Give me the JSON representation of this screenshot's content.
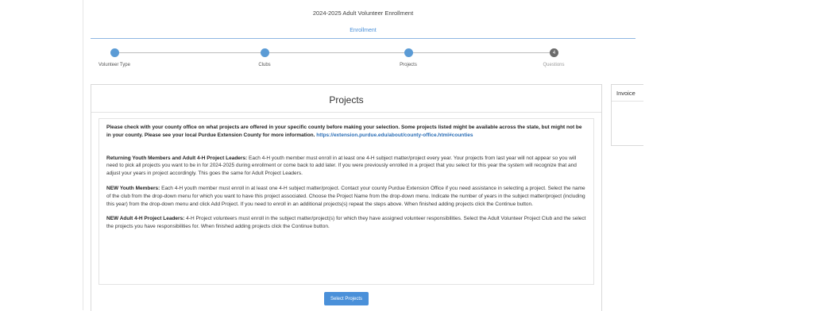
{
  "header": {
    "enrollment_title": "2024-2025 Adult Volunteer Enrollment",
    "tab_label": "Enrollment"
  },
  "steps": [
    {
      "label": "Volunteer Type",
      "number": "",
      "state": "complete"
    },
    {
      "label": "Clubs",
      "number": "",
      "state": "complete"
    },
    {
      "label": "Projects",
      "number": "",
      "state": "current"
    },
    {
      "label": "Questions",
      "number": "4",
      "state": "pending"
    }
  ],
  "projects_card": {
    "title": "Projects",
    "intro": "Please check with your county office on what projects are offered in your specific county before making your selection. Some projects listed might be available across the state, but might not be in your county. Please see your local Purdue Extension County for more information.",
    "intro_link": "https://extension.purdue.edu/about/county-office.html#counties",
    "returning_heading": "Returning Youth Members and Adult 4-H Project Leaders:",
    "returning_text": "Each 4-H youth member must enroll in at least one 4-H subject matter/project every year. Your projects from last year will not appear so you will need to pick all projects you want to be in for 2024-2025 during enrollment or come back to add later. If you were previously enrolled in a project that you select for this year the system will recognize that and adjust your years in project accordingly. This goes the same for Adult Project Leaders.",
    "new_youth_heading": "NEW Youth Members:",
    "new_youth_text": "Each 4-H youth member must enroll in at least one 4-H subject matter/project. Contact your county Purdue Extension Office if you need assistance in selecting a project. Select the name of the club from the drop-down menu for which you want to have this project associated. Choose the Project Name from the drop-down menu. Indicate the number of years in the subject matter/project (including this year) from the drop-down menu and click Add Project. If you need to enroll in an additional projects(s) repeat the steps above. When finished adding projects click the Continue button.",
    "new_adult_heading": "NEW Adult 4-H Project Leaders:",
    "new_adult_text": "4-H Project volunteers must enroll in the subject matter/project(s) for which they have assigned volunteer responsibilities. Select the Adult Volunteer Project Club and the select the projects you have responsibilities for. When finished adding projects click the Continue button.",
    "select_button": "Select Projects"
  },
  "side_card": {
    "title": "Invoice"
  },
  "colors": {
    "accent": "#4a90d9",
    "step_done": "#5b9bd5",
    "step_pending": "#6b6b6b"
  }
}
